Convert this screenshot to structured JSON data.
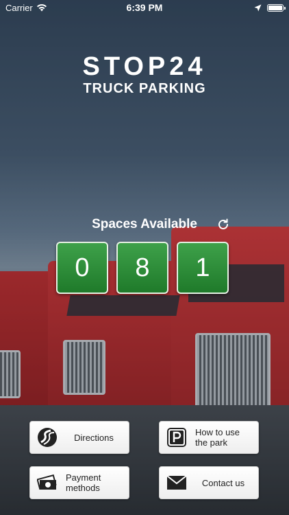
{
  "status_bar": {
    "carrier": "Carrier",
    "time": "6:39 PM"
  },
  "logo": {
    "title": "STOP24",
    "subtitle": "TRUCK PARKING"
  },
  "spaces": {
    "label": "Spaces Available",
    "digits": [
      "0",
      "8",
      "1"
    ]
  },
  "buttons": {
    "directions": "Directions",
    "how_to": "How to use the park",
    "payment": "Payment methods",
    "contact": "Contact us"
  },
  "colors": {
    "digit_bg": "#2a8a35",
    "button_bg": "#ffffff",
    "text_on_bg": "#ffffff"
  }
}
